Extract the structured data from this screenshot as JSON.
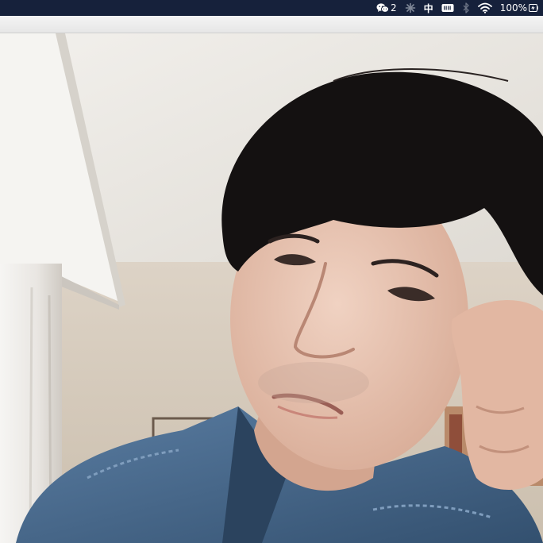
{
  "menubar": {
    "background": "#16213b",
    "wechat": {
      "icon": "wechat-icon",
      "badge": "2"
    },
    "status_icon": "asterisk-icon",
    "input_method": "中",
    "keyboard_icon": "keyboard-icon",
    "bluetooth_icon": "bluetooth-icon",
    "wifi_icon": "wifi-icon",
    "battery": {
      "percent": "100%",
      "icon": "battery-charging-icon"
    }
  },
  "window": {
    "strip_color": "#eeeeee"
  },
  "camera": {
    "colors": {
      "ceiling": "#ece9e3",
      "wall": "#d9cfc1",
      "curtain": "#f1efec",
      "hair": "#141111",
      "skin": "#e4c2b0",
      "jacket": "#4a6a8c"
    }
  }
}
